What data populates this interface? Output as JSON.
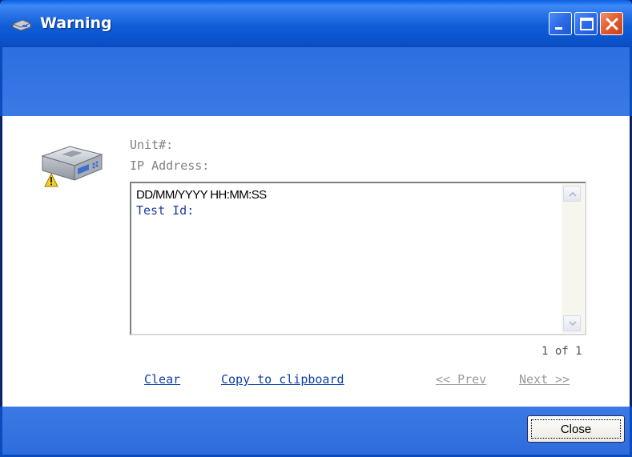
{
  "window": {
    "title": "Warning",
    "icons": {
      "title_icon": "device-icon",
      "minimize": "minimize-icon",
      "maximize": "maximize-icon",
      "close": "close-icon"
    },
    "colors": {
      "titlebar": "#0b55cf",
      "band": "#3a7ae6",
      "close_button": "#e25a2c"
    }
  },
  "details": {
    "device_icon": "device-warning-icon",
    "unit_label": "Unit#:",
    "ip_label": "IP Address:"
  },
  "message": {
    "timestamp": "DD/MM/YYYY HH:MM:SS",
    "test_id_label": "Test Id:"
  },
  "pager": {
    "text": "1 of 1"
  },
  "links": {
    "clear": "Clear",
    "copy": "Copy to clipboard",
    "prev": "<< Prev",
    "next": "Next >>"
  },
  "footer": {
    "close_label": "Close"
  }
}
